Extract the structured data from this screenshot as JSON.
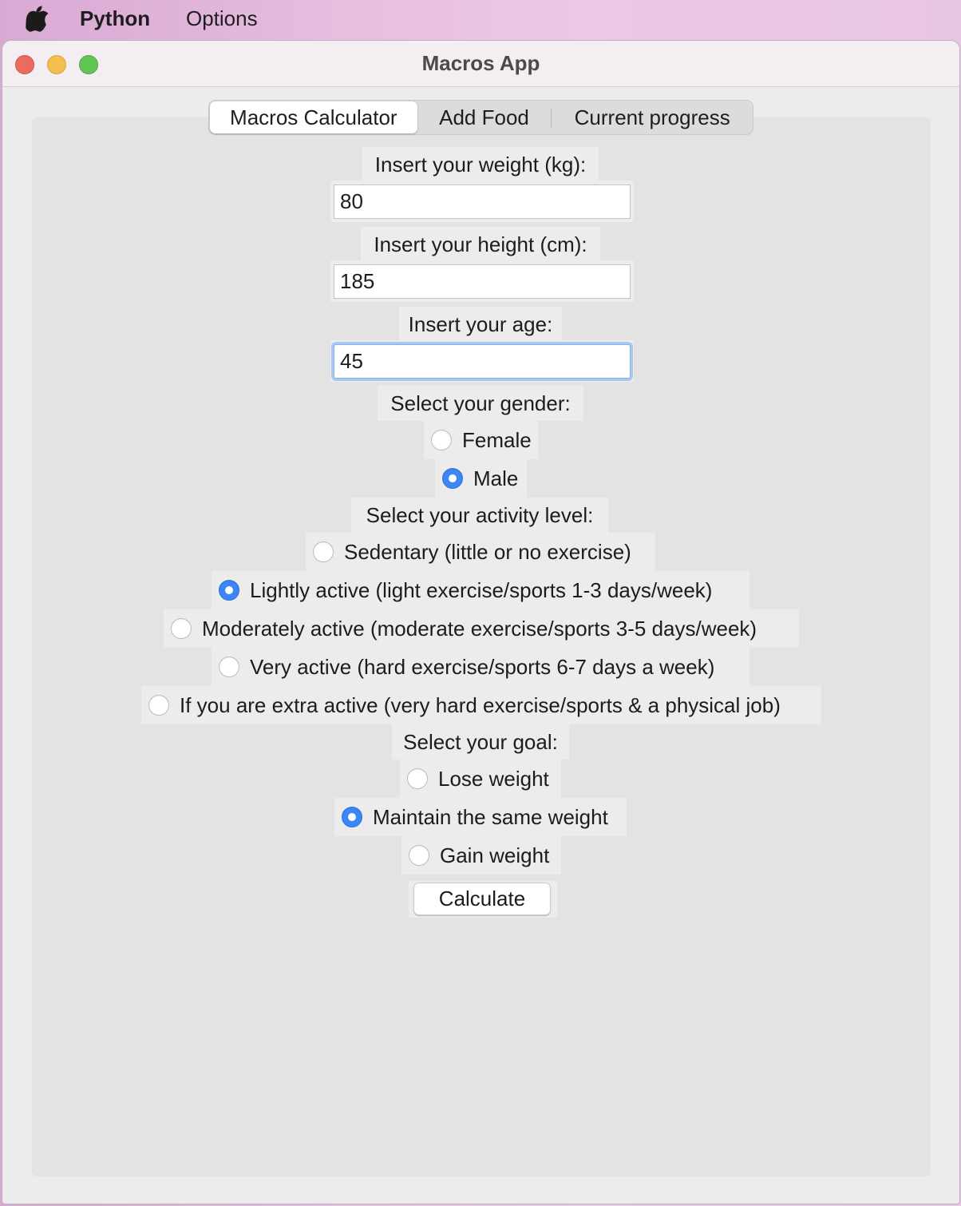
{
  "menubar": {
    "app_name": "Python",
    "options_label": "Options",
    "apple_icon": "apple-logo-icon"
  },
  "window": {
    "title": "Macros App"
  },
  "tabs": [
    {
      "label": "Macros Calculator",
      "selected": true
    },
    {
      "label": "Add Food",
      "selected": false
    },
    {
      "label": "Current progress",
      "selected": false
    }
  ],
  "form": {
    "weight": {
      "label": "Insert your weight (kg):",
      "value": "80"
    },
    "height": {
      "label": "Insert your height (cm):",
      "value": "185"
    },
    "age": {
      "label": "Insert your age:",
      "value": "45"
    },
    "gender": {
      "label": "Select your gender:",
      "options": [
        {
          "label": "Female",
          "selected": false
        },
        {
          "label": "Male",
          "selected": true
        }
      ]
    },
    "activity": {
      "label": "Select your activity level:",
      "options": [
        {
          "label": "Sedentary (little or no exercise)",
          "selected": false
        },
        {
          "label": "Lightly active (light exercise/sports 1-3 days/week)",
          "selected": true
        },
        {
          "label": "Moderately active (moderate exercise/sports 3-5 days/week)",
          "selected": false
        },
        {
          "label": "Very active (hard exercise/sports 6-7 days a week)",
          "selected": false
        },
        {
          "label": "If you are extra active (very hard exercise/sports & a physical job)",
          "selected": false
        }
      ]
    },
    "goal": {
      "label": "Select your goal:",
      "options": [
        {
          "label": "Lose weight",
          "selected": false
        },
        {
          "label": "Maintain the same weight",
          "selected": true
        },
        {
          "label": "Gain weight",
          "selected": false
        }
      ]
    },
    "calculate_label": "Calculate"
  },
  "colors": {
    "accent": "#3d86f5",
    "focus_ring": "#a9c8f3"
  }
}
